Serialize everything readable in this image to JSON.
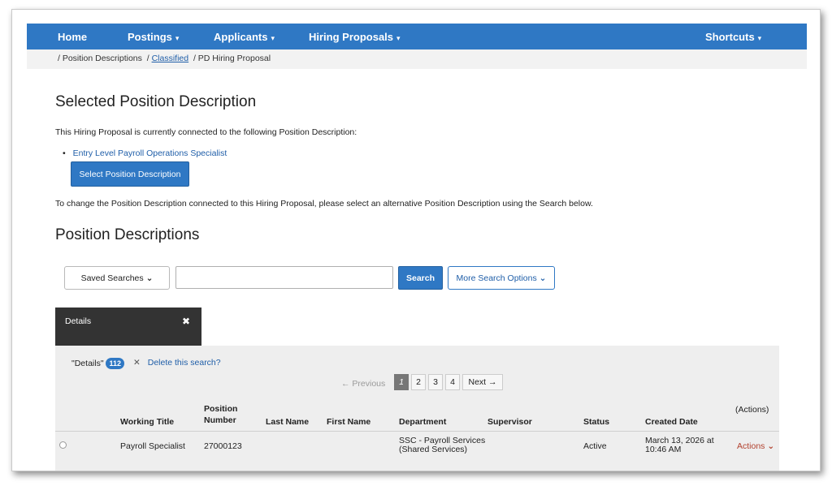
{
  "nav": {
    "home": "Home",
    "postings": "Postings",
    "applicants": "Applicants",
    "hiring_proposals": "Hiring Proposals",
    "shortcuts": "Shortcuts",
    "caret": "▾"
  },
  "breadcrumb": {
    "sep1": "/",
    "item1": "Position Descriptions",
    "sep2": "/",
    "item2": "Classified",
    "sep3": "/",
    "item3": "PD Hiring Proposal"
  },
  "selected": {
    "title": "Selected Position Description",
    "intro": "This Hiring Proposal is currently connected to the following Position Description:",
    "bullet": "•",
    "pd_link": "Entry Level Payroll Operations Specialist",
    "select_button": "Select Position Description",
    "change_note": "To change the Position Description connected to this Hiring Proposal, please select an alternative Position Description using the Search below."
  },
  "search": {
    "title": "Position Descriptions",
    "saved_searches": "Saved Searches",
    "search_button": "Search",
    "more_options": "More Search Options",
    "input_value": "",
    "chevron": "⌄"
  },
  "filter_tab": {
    "label": "Details",
    "close": "✖"
  },
  "results": {
    "search_name": "\"Details\"",
    "count": "112",
    "delete_x": "✕",
    "delete_label": "Delete this search?",
    "pager": {
      "previous": "← Previous",
      "pages": [
        "1",
        "2",
        "3",
        "4"
      ],
      "next": "Next →"
    },
    "columns": {
      "working_title": "Working Title",
      "position_number_1": "Position",
      "position_number_2": "Number",
      "last_name": "Last Name",
      "first_name": "First Name",
      "department": "Department",
      "supervisor": "Supervisor",
      "status": "Status",
      "created_date": "Created Date",
      "actions": "(Actions)"
    },
    "rows": [
      {
        "working_title": "Payroll Specialist",
        "position_number": "27000123",
        "last_name": "",
        "first_name": "",
        "department_1": "SSC - Payroll Services",
        "department_2": "(Shared Services)",
        "supervisor": "",
        "status": "Active",
        "created_1": "March 13, 2026 at",
        "created_2": "10:46 AM",
        "actions": "Actions"
      }
    ]
  },
  "colors": {
    "primary": "#2f78c4",
    "link": "#1f5ea8",
    "danger": "#b2412e",
    "dark_tab": "#333333"
  }
}
